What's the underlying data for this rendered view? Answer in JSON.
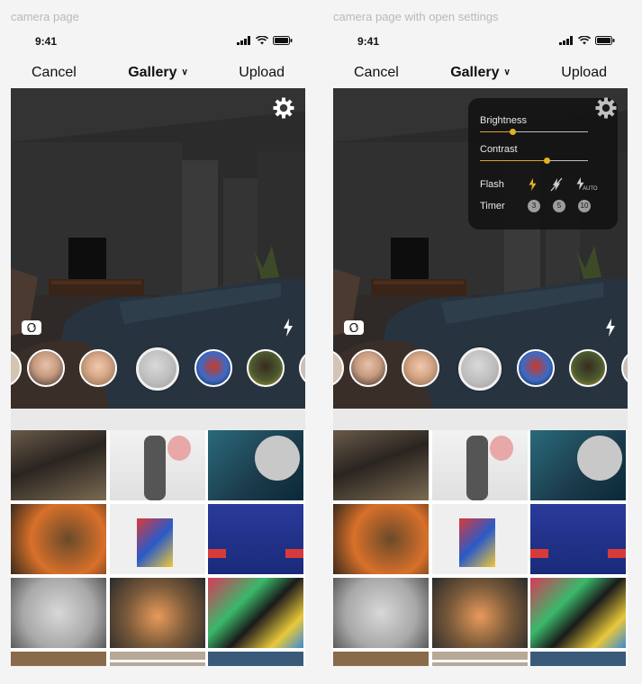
{
  "frames": [
    {
      "label": "camera page",
      "status_time": "9:41",
      "nav": {
        "cancel": "Cancel",
        "title": "Gallery",
        "upload": "Upload"
      },
      "settings_open": false
    },
    {
      "label": "camera page with open settings",
      "status_time": "9:41",
      "nav": {
        "cancel": "Cancel",
        "title": "Gallery",
        "upload": "Upload"
      },
      "settings_open": true,
      "settings": {
        "brightness_label": "Brightness",
        "brightness_value": 0.3,
        "contrast_label": "Contrast",
        "contrast_value": 0.62,
        "flash_label": "Flash",
        "flash_auto_label": "AUTO",
        "timer_label": "Timer",
        "timer_options": [
          "3",
          "5",
          "10"
        ]
      }
    }
  ],
  "icons": {
    "settings": "gear-icon",
    "flip_camera": "camera-flip-icon",
    "flash": "lightning-icon",
    "dropdown": "chevron-down-icon"
  },
  "colors": {
    "accent": "#e3b21f",
    "panel_bg": "#121212",
    "page_bg": "#f4f4f4"
  }
}
